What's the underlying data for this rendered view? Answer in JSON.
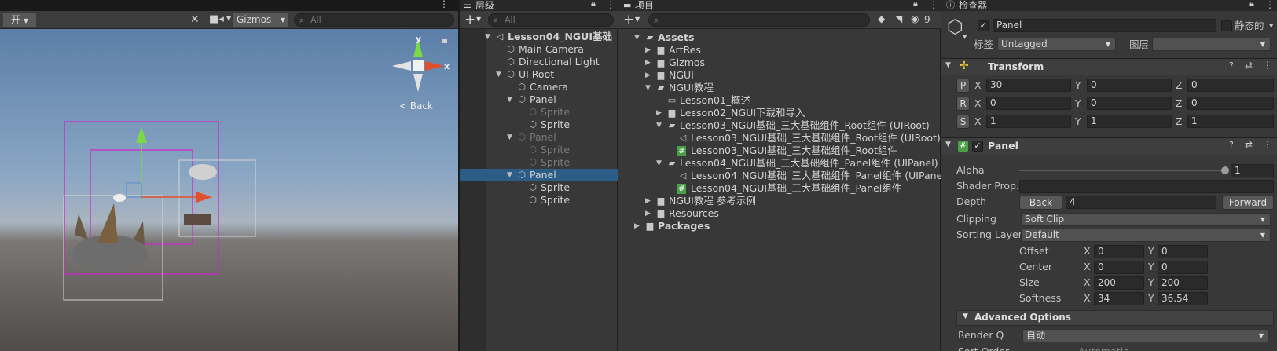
{
  "scene": {
    "toolbar": {
      "draw_mode_glyph": "开",
      "gizmos_label": "Gizmos",
      "search_placeholder": "All"
    },
    "orientation": {
      "y_label": "y",
      "x_label": "x",
      "back_label": "< Back"
    }
  },
  "hierarchy": {
    "tab_label": "层级",
    "search_placeholder": "All",
    "rows": [
      {
        "label": "Lesson04_NGUI基础",
        "depth": 0,
        "icon": "unity-scene-icon",
        "expanded": true,
        "bold": true
      },
      {
        "label": "Main Camera",
        "depth": 1,
        "icon": "gameobject-icon"
      },
      {
        "label": "Directional Light",
        "depth": 1,
        "icon": "gameobject-icon"
      },
      {
        "label": "UI Root",
        "depth": 1,
        "icon": "gameobject-icon",
        "expanded": true
      },
      {
        "label": "Camera",
        "depth": 2,
        "icon": "gameobject-icon"
      },
      {
        "label": "Panel",
        "depth": 2,
        "icon": "gameobject-icon",
        "expanded": true
      },
      {
        "label": "Sprite",
        "depth": 3,
        "icon": "gameobject-icon",
        "dim": true
      },
      {
        "label": "Sprite",
        "depth": 3,
        "icon": "gameobject-icon"
      },
      {
        "label": "Panel",
        "depth": 2,
        "icon": "gameobject-icon",
        "expanded": true,
        "dim": true
      },
      {
        "label": "Sprite",
        "depth": 3,
        "icon": "gameobject-icon",
        "dim": true
      },
      {
        "label": "Sprite",
        "depth": 3,
        "icon": "gameobject-icon",
        "dim": true
      },
      {
        "label": "Panel",
        "depth": 2,
        "icon": "gameobject-icon",
        "expanded": true,
        "selected": true
      },
      {
        "label": "Sprite",
        "depth": 3,
        "icon": "gameobject-icon"
      },
      {
        "label": "Sprite",
        "depth": 3,
        "icon": "gameobject-icon"
      }
    ]
  },
  "project": {
    "tab_label": "项目",
    "hidden_count": "9",
    "rows": [
      {
        "label": "Assets",
        "depth": 0,
        "icon": "folder-open-icon",
        "expanded": true,
        "bold": true
      },
      {
        "label": "ArtRes",
        "depth": 1,
        "icon": "folder-icon",
        "collapsed": true
      },
      {
        "label": "Gizmos",
        "depth": 1,
        "icon": "folder-icon",
        "collapsed": true
      },
      {
        "label": "NGUI",
        "depth": 1,
        "icon": "folder-icon",
        "collapsed": true
      },
      {
        "label": "NGUI教程",
        "depth": 1,
        "icon": "folder-open-icon",
        "expanded": true
      },
      {
        "label": "Lesson01_概述",
        "depth": 2,
        "icon": "folder-empty-icon"
      },
      {
        "label": "Lesson02_NGUI下载和导入",
        "depth": 2,
        "icon": "folder-icon",
        "collapsed": true
      },
      {
        "label": "Lesson03_NGUI基础_三大基础组件_Root组件 (UIRoot)",
        "depth": 2,
        "icon": "folder-open-icon",
        "expanded": true
      },
      {
        "label": "Lesson03_NGUI基础_三大基础组件_Root组件 (UIRoot)",
        "depth": 3,
        "icon": "unity-scene-icon"
      },
      {
        "label": "Lesson03_NGUI基础_三大基础组件_Root组件",
        "depth": 3,
        "icon": "csharp-script-icon"
      },
      {
        "label": "Lesson04_NGUI基础_三大基础组件_Panel组件 (UIPanel)",
        "depth": 2,
        "icon": "folder-open-icon",
        "expanded": true
      },
      {
        "label": "Lesson04_NGUI基础_三大基础组件_Panel组件 (UIPanel)",
        "depth": 3,
        "icon": "unity-scene-icon"
      },
      {
        "label": "Lesson04_NGUI基础_三大基础组件_Panel组件",
        "depth": 3,
        "icon": "csharp-script-icon"
      },
      {
        "label": "NGUI教程 参考示例",
        "depth": 1,
        "icon": "folder-icon",
        "collapsed": true
      },
      {
        "label": "Resources",
        "depth": 1,
        "icon": "folder-icon",
        "collapsed": true
      },
      {
        "label": "Packages",
        "depth": 0,
        "icon": "folder-icon",
        "collapsed": true,
        "bold": true
      }
    ]
  },
  "inspector": {
    "tab_label": "检查器",
    "object_name": "Panel",
    "active": true,
    "static_label": "静态的",
    "tag_label": "标签",
    "tag_value": "Untagged",
    "layer_label": "图层",
    "layer_value": "",
    "transform": {
      "title": "Transform",
      "rows": [
        {
          "btn": "P",
          "x": "30",
          "y": "0",
          "z": "0"
        },
        {
          "btn": "R",
          "x": "0",
          "y": "0",
          "z": "0"
        },
        {
          "btn": "S",
          "x": "1",
          "y": "1",
          "z": "1"
        }
      ],
      "axis_x": "X",
      "axis_y": "Y",
      "axis_z": "Z"
    },
    "panel": {
      "title": "Panel",
      "alpha_label": "Alpha",
      "alpha_value": "1",
      "alpha_fraction": 1.0,
      "shader_label": "Shader Prop.",
      "shader_value": "",
      "depth_label": "Depth",
      "depth_back": "Back",
      "depth_value": "4",
      "depth_forward": "Forward",
      "clipping_label": "Clipping",
      "clipping_value": "Soft Clip",
      "sorting_label": "Sorting Layer",
      "sorting_value": "Default",
      "offset_label": "Offset",
      "offset_x": "0",
      "offset_y": "0",
      "center_label": "Center",
      "center_x": "0",
      "center_y": "0",
      "size_label": "Size",
      "size_x": "200",
      "size_y": "200",
      "softness_label": "Softness",
      "softness_x": "34",
      "softness_y": "36.54",
      "xy_x": "X",
      "xy_y": "Y",
      "advanced_label": "Advanced Options",
      "render_q_label": "Render Q",
      "render_q_value": "自动",
      "sort_order_label": "Sort Order",
      "sort_order_hint": "Automatic"
    }
  }
}
